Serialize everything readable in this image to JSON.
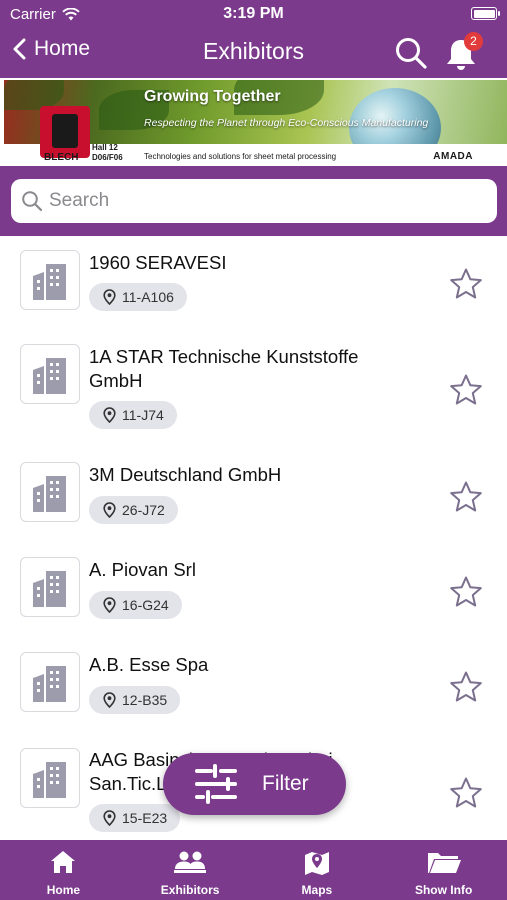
{
  "status_bar": {
    "carrier": "Carrier",
    "time": "3:19 PM"
  },
  "nav": {
    "back_label": "Home",
    "title": "Exhibitors",
    "notification_count": "2"
  },
  "banner": {
    "headline": "Growing Together",
    "subline": "Respecting the Planet through Eco-Conscious Manufacturing",
    "brand": "BLECH",
    "hall_line1": "Hall 12",
    "hall_line2": "D06/F06",
    "tagline": "Technologies and solutions for sheet metal processing",
    "sponsor": "AMADA"
  },
  "search": {
    "placeholder": "Search"
  },
  "exhibitors": [
    {
      "name": "1960 SERAVESI",
      "booth": "11-A106"
    },
    {
      "name": "1A STAR Technische Kunststoffe GmbH",
      "booth": "11-J74"
    },
    {
      "name": "3M Deutschland GmbH",
      "booth": "26-J72"
    },
    {
      "name": "A. Piovan Srl",
      "booth": "16-G24"
    },
    {
      "name": "A.B. Esse Spa",
      "booth": "12-B35"
    },
    {
      "name": "AAG Basinclı Hava Sistemleri San.Tic.Ltd.Şti.",
      "booth": "15-E23"
    }
  ],
  "filter_label": "Filter",
  "tabs": [
    {
      "label": "Home",
      "icon": "home-icon"
    },
    {
      "label": "Exhibitors",
      "icon": "people-icon"
    },
    {
      "label": "Maps",
      "icon": "map-icon"
    },
    {
      "label": "Show Info",
      "icon": "folder-icon"
    }
  ],
  "colors": {
    "brand": "#7b3a8c",
    "badge": "#e23b3b",
    "chip": "#e3e3ea",
    "star": "#7b6f8e"
  }
}
